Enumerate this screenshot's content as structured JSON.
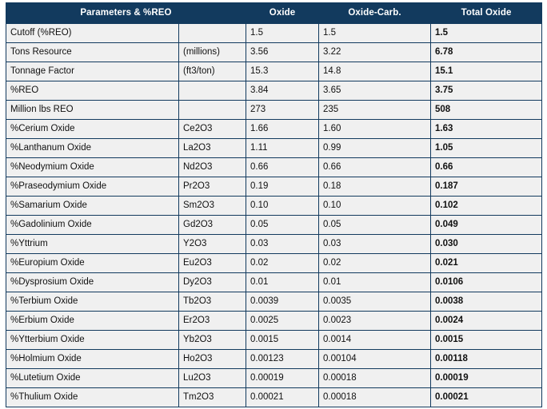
{
  "table": {
    "headers": {
      "parameters": "Parameters & %REO",
      "symbol": "",
      "oxide": "Oxide",
      "oxide_carb": "Oxide-Carb.",
      "total_oxide": "Total Oxide"
    },
    "colors": {
      "header_background": "#123a5e",
      "header_text": "#ffffff",
      "cell_background": "#f0f0f0",
      "cell_text": "#111111",
      "border": "#123a5e",
      "page_background": "#ffffff"
    },
    "rows": [
      {
        "name": "Cutoff (%REO)",
        "symbol": "",
        "oxide": "1.5",
        "oxide_carb": "1.5",
        "total_oxide": "1.5"
      },
      {
        "name": "Tons Resource",
        "symbol": "(millions)",
        "oxide": "3.56",
        "oxide_carb": "3.22",
        "total_oxide": "6.78"
      },
      {
        "name": "Tonnage Factor",
        "symbol": "(ft3/ton)",
        "oxide": "15.3",
        "oxide_carb": "14.8",
        "total_oxide": "15.1"
      },
      {
        "name": "%REO",
        "symbol": "",
        "oxide": "3.84",
        "oxide_carb": "3.65",
        "total_oxide": "3.75"
      },
      {
        "name": "Million lbs REO",
        "symbol": "",
        "oxide": "273",
        "oxide_carb": "235",
        "total_oxide": "508"
      },
      {
        "name": "%Cerium Oxide",
        "symbol": "Ce2O3",
        "oxide": "1.66",
        "oxide_carb": "1.60",
        "total_oxide": "1.63"
      },
      {
        "name": "%Lanthanum Oxide",
        "symbol": "La2O3",
        "oxide": "1.11",
        "oxide_carb": "0.99",
        "total_oxide": "1.05"
      },
      {
        "name": "%Neodymium Oxide",
        "symbol": "Nd2O3",
        "oxide": "0.66",
        "oxide_carb": "0.66",
        "total_oxide": "0.66"
      },
      {
        "name": "%Praseodymium Oxide",
        "symbol": "Pr2O3",
        "oxide": "0.19",
        "oxide_carb": "0.18",
        "total_oxide": "0.187"
      },
      {
        "name": "%Samarium Oxide",
        "symbol": "Sm2O3",
        "oxide": "0.10",
        "oxide_carb": "0.10",
        "total_oxide": "0.102"
      },
      {
        "name": "%Gadolinium Oxide",
        "symbol": "Gd2O3",
        "oxide": "0.05",
        "oxide_carb": "0.05",
        "total_oxide": "0.049"
      },
      {
        "name": "%Yttrium",
        "symbol": "Y2O3",
        "oxide": "0.03",
        "oxide_carb": "0.03",
        "total_oxide": "0.030"
      },
      {
        "name": "%Europium Oxide",
        "symbol": "Eu2O3",
        "oxide": "0.02",
        "oxide_carb": "0.02",
        "total_oxide": "0.021"
      },
      {
        "name": "%Dysprosium Oxide",
        "symbol": "Dy2O3",
        "oxide": "0.01",
        "oxide_carb": "0.01",
        "total_oxide": "0.0106"
      },
      {
        "name": "%Terbium Oxide",
        "symbol": "Tb2O3",
        "oxide": "0.0039",
        "oxide_carb": "0.0035",
        "total_oxide": "0.0038"
      },
      {
        "name": "%Erbium Oxide",
        "symbol": "Er2O3",
        "oxide": "0.0025",
        "oxide_carb": "0.0023",
        "total_oxide": "0.0024"
      },
      {
        "name": "%Ytterbium Oxide",
        "symbol": "Yb2O3",
        "oxide": "0.0015",
        "oxide_carb": "0.0014",
        "total_oxide": "0.0015"
      },
      {
        "name": "%Holmium Oxide",
        "symbol": "Ho2O3",
        "oxide": "0.00123",
        "oxide_carb": "0.00104",
        "total_oxide": "0.00118"
      },
      {
        "name": "%Lutetium Oxide",
        "symbol": "Lu2O3",
        "oxide": "0.00019",
        "oxide_carb": "0.00018",
        "total_oxide": "0.00019"
      },
      {
        "name": "%Thulium Oxide",
        "symbol": "Tm2O3",
        "oxide": "0.00021",
        "oxide_carb": "0.00018",
        "total_oxide": "0.00021"
      }
    ]
  }
}
